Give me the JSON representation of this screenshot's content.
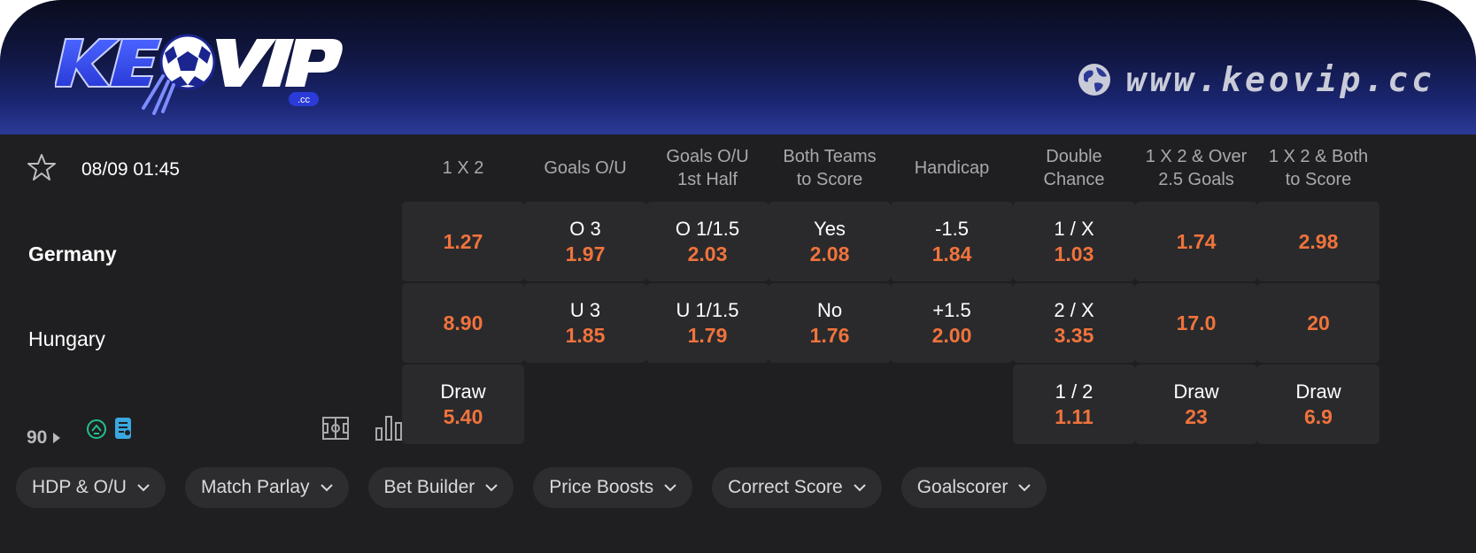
{
  "brand": {
    "logo_text": "KEOVIP",
    "logo_subtext": ".cc",
    "url": "www.keovip.cc"
  },
  "colors": {
    "odds": "#f0733c",
    "accent_green": "#22c08a",
    "accent_blue": "#3aa7e0",
    "header_blue": "#2b3a96"
  },
  "match": {
    "datetime": "08/09 01:45",
    "home": "Germany",
    "away": "Hungary",
    "minute": "90"
  },
  "markets": [
    {
      "header": "1 X 2",
      "home": {
        "label": "",
        "odd": "1.27"
      },
      "away": {
        "label": "",
        "odd": "8.90"
      },
      "draw": {
        "label": "Draw",
        "odd": "5.40"
      }
    },
    {
      "header": "Goals O/U",
      "home": {
        "label": "O 3",
        "odd": "1.97"
      },
      "away": {
        "label": "U 3",
        "odd": "1.85"
      }
    },
    {
      "header": "Goals O/U\n1st Half",
      "home": {
        "label": "O 1/1.5",
        "odd": "2.03"
      },
      "away": {
        "label": "U 1/1.5",
        "odd": "1.79"
      }
    },
    {
      "header": "Both Teams\nto Score",
      "home": {
        "label": "Yes",
        "odd": "2.08"
      },
      "away": {
        "label": "No",
        "odd": "1.76"
      }
    },
    {
      "header": "Handicap",
      "home": {
        "label": "-1.5",
        "odd": "1.84"
      },
      "away": {
        "label": "+1.5",
        "odd": "2.00"
      }
    },
    {
      "header": "Double\nChance",
      "home": {
        "label": "1 / X",
        "odd": "1.03"
      },
      "away": {
        "label": "2 / X",
        "odd": "3.35"
      },
      "draw": {
        "label": "1 / 2",
        "odd": "1.11"
      }
    },
    {
      "header": "1 X 2 & Over\n2.5 Goals",
      "home": {
        "label": "",
        "odd": "1.74"
      },
      "away": {
        "label": "",
        "odd": "17.0"
      },
      "draw": {
        "label": "Draw",
        "odd": "23"
      }
    },
    {
      "header": "1 X 2 & Both\nto Score",
      "home": {
        "label": "",
        "odd": "2.98"
      },
      "away": {
        "label": "",
        "odd": "20"
      },
      "draw": {
        "label": "Draw",
        "odd": "6.9"
      }
    }
  ],
  "filters": [
    "HDP & O/U",
    "Match Parlay",
    "Bet Builder",
    "Price Boosts",
    "Correct Score",
    "Goalscorer"
  ],
  "icons": [
    "star-icon",
    "globe-icon",
    "triangle-right-icon",
    "live-stream-icon",
    "ticket-icon",
    "pitch-icon",
    "stats-icon",
    "chevron-down-icon"
  ]
}
